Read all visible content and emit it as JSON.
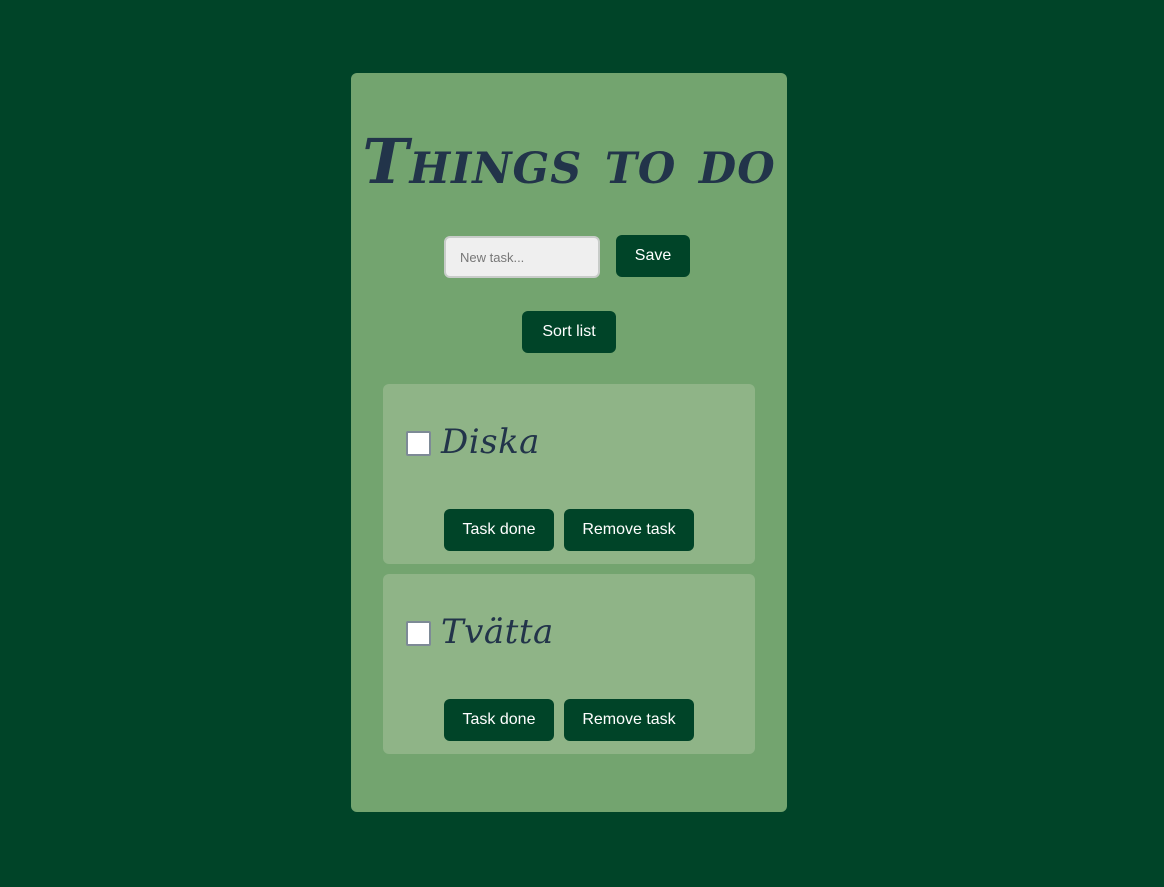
{
  "app": {
    "title": "Things to do"
  },
  "new_task": {
    "placeholder": "New task...",
    "value": "",
    "save_label": "Save"
  },
  "sort": {
    "label": "Sort list"
  },
  "tasks": [
    {
      "name": "Diska",
      "checked": false,
      "done_label": "Task done",
      "remove_label": "Remove task"
    },
    {
      "name": "Tvätta",
      "checked": false,
      "done_label": "Task done",
      "remove_label": "Remove task"
    }
  ],
  "colors": {
    "background": "#004428",
    "card": "#73a46f",
    "task_card": "#8fb487",
    "button": "#004428",
    "title_text": "#22344a"
  }
}
